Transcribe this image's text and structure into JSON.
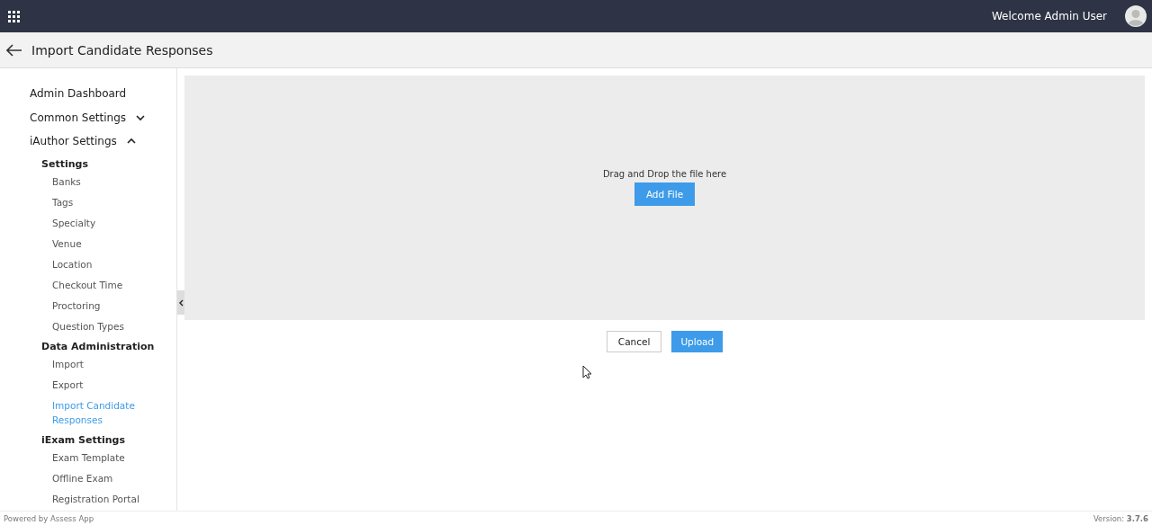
{
  "top_bar": {
    "welcome": "Welcome Admin User"
  },
  "page_header": {
    "title": "Import Candidate Responses"
  },
  "sidebar": {
    "items": [
      {
        "label": "Admin Dashboard",
        "kind": "link",
        "selected": false
      },
      {
        "label": "Common Settings",
        "kind": "section",
        "expanded": false
      },
      {
        "label": "iAuthor Settings",
        "kind": "section",
        "expanded": true,
        "children": [
          {
            "label": "Settings",
            "children": [
              {
                "label": "Banks",
                "selected": false
              },
              {
                "label": "Tags",
                "selected": false
              },
              {
                "label": "Specialty",
                "selected": false
              },
              {
                "label": "Venue",
                "selected": false
              },
              {
                "label": "Location",
                "selected": false
              },
              {
                "label": "Checkout Time",
                "selected": false
              },
              {
                "label": "Proctoring",
                "selected": false
              },
              {
                "label": "Question Types",
                "selected": false
              }
            ]
          },
          {
            "label": "Data Administration",
            "children": [
              {
                "label": "Import",
                "selected": false
              },
              {
                "label": "Export",
                "selected": false
              },
              {
                "label": "Import Candidate Responses",
                "selected": true
              }
            ]
          },
          {
            "label": "iExam Settings",
            "children": [
              {
                "label": "Exam Template",
                "selected": false
              },
              {
                "label": "Offline Exam",
                "selected": false
              },
              {
                "label": "Registration Portal",
                "selected": false
              }
            ]
          }
        ]
      }
    ]
  },
  "dropzone": {
    "hint": "Drag and Drop the file here",
    "button": "Add File"
  },
  "actions": {
    "cancel": "Cancel",
    "upload": "Upload"
  },
  "footer": {
    "powered_by": "Powered by Assess App",
    "version": "Version: **3.7.6**"
  }
}
